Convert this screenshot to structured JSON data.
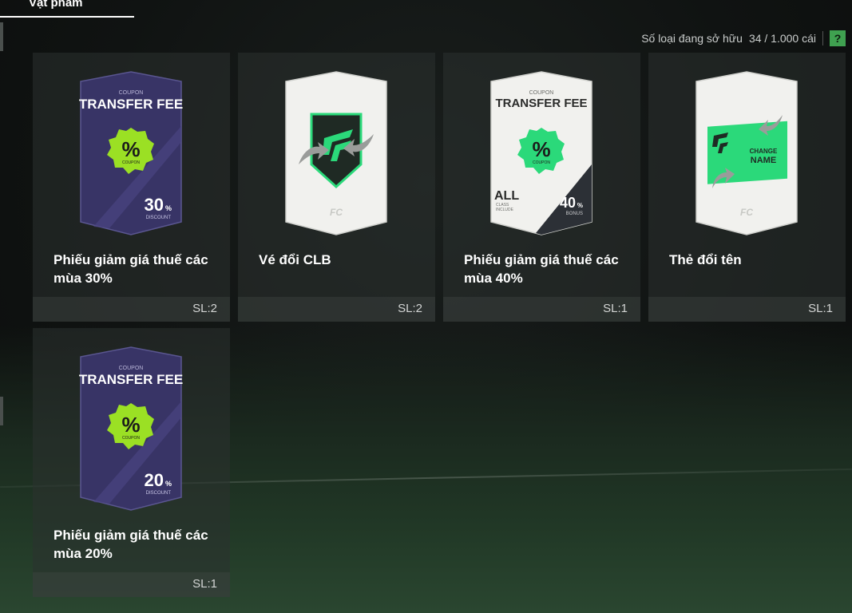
{
  "tab": {
    "label": "Vật phẩm"
  },
  "owned": {
    "label": "Số loại đang sở hữu",
    "count": "34 / 1.000 cái",
    "help": "?"
  },
  "items": [
    {
      "name": "Phiếu giảm giá thuế các mùa 30%",
      "qty": "SL:2",
      "card": {
        "kind": "coupon-dark",
        "coupon": "COUPON",
        "title": "TRANSFER FEE",
        "pct": "%",
        "pct_sub": "COUPON",
        "value": "30",
        "unit": "%",
        "caption": "DISCOUNT"
      }
    },
    {
      "name": "Vé đổi CLB",
      "qty": "SL:2",
      "card": {
        "kind": "club"
      }
    },
    {
      "name": "Phiếu giảm giá thuế các mùa 40%",
      "qty": "SL:1",
      "card": {
        "kind": "coupon-light",
        "coupon": "COUPON",
        "title": "TRANSFER FEE",
        "pct": "%",
        "pct_sub": "COUPON",
        "value": "40",
        "unit": "%",
        "caption": "BONUS",
        "left_big": "ALL",
        "left_small1": "CLASS",
        "left_small2": "INCLUDE"
      }
    },
    {
      "name": "Thẻ đổi tên",
      "qty": "SL:1",
      "card": {
        "kind": "rename",
        "line1": "CHANGE",
        "line2": "NAME"
      }
    },
    {
      "name": "Phiếu giảm giá thuế các mùa 20%",
      "qty": "SL:1",
      "card": {
        "kind": "coupon-dark",
        "coupon": "COUPON",
        "title": "TRANSFER FEE",
        "pct": "%",
        "pct_sub": "COUPON",
        "value": "20",
        "unit": "%",
        "caption": "DISCOUNT"
      }
    }
  ],
  "colors": {
    "accent": "#3fa150",
    "coupon_dark": "#3a3568",
    "coupon_green": "#9be024",
    "fc_green": "#2bd97a"
  }
}
